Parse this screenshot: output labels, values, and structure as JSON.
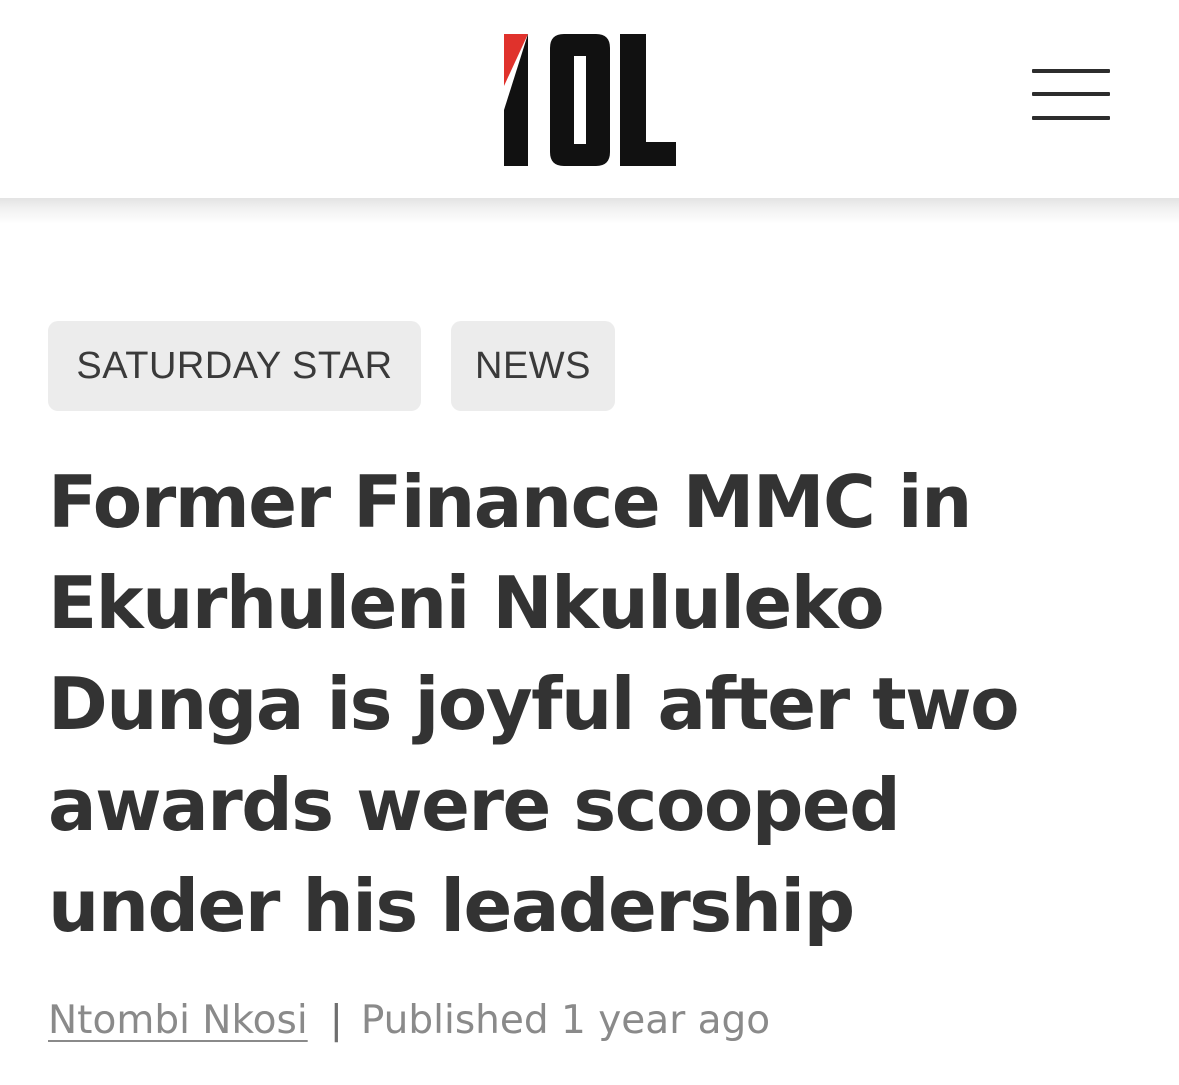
{
  "header": {
    "logo_text": "IOL",
    "menu_icon": "hamburger-menu-icon",
    "brand_colors": {
      "logo_black": "#111111",
      "logo_red": "#e0322c"
    }
  },
  "article": {
    "tags": [
      "SATURDAY STAR",
      "NEWS"
    ],
    "headline": "Former Finance MMC in Ekurhuleni Nkululeko Dunga is joyful after two awards were scooped under his leadership",
    "author": "Ntombi Nkosi",
    "separator": "|",
    "published": "Published 1 year ago"
  },
  "colors": {
    "text_dark": "#333333",
    "text_muted": "#8a8a8a",
    "tag_background": "#ececec"
  }
}
